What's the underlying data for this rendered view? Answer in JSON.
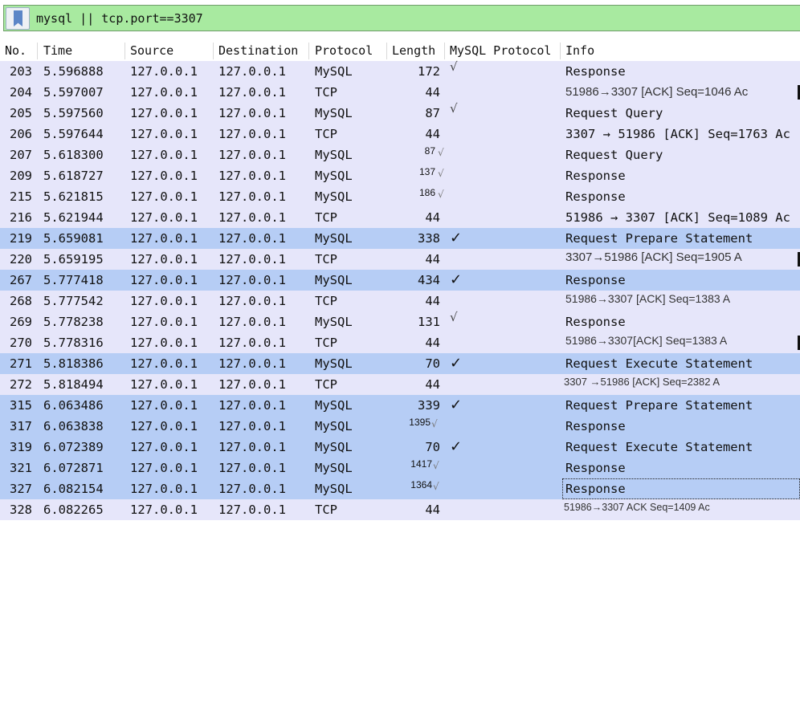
{
  "filter": {
    "text": "mysql || tcp.port==3307",
    "bookmark_icon": "bookmark-icon"
  },
  "columns": [
    "No.",
    "Time",
    "Source",
    "Destination",
    "Protocol",
    "Length",
    "MySQL Protocol",
    "Info"
  ],
  "rows": [
    {
      "no": "203",
      "time": "5.596888",
      "src": "127.0.0.1",
      "dst": "127.0.0.1",
      "proto": "MySQL",
      "len": "172",
      "check": "√",
      "info": "Response"
    },
    {
      "no": "204",
      "time": "5.597007",
      "src": "127.0.0.1",
      "dst": "127.0.0.1",
      "proto": "TCP",
      "len": "44",
      "check": "",
      "info": "51986→3307 [ACK] Seq=1046 Ac"
    },
    {
      "no": "205",
      "time": "5.597560",
      "src": "127.0.0.1",
      "dst": "127.0.0.1",
      "proto": "MySQL",
      "len": "87",
      "check": "√",
      "info": "Request Query"
    },
    {
      "no": "206",
      "time": "5.597644",
      "src": "127.0.0.1",
      "dst": "127.0.0.1",
      "proto": "TCP",
      "len": "44",
      "check": "",
      "info": "3307 → 51986 [ACK] Seq=1763 Ac"
    },
    {
      "no": "207",
      "time": "5.618300",
      "src": "127.0.0.1",
      "dst": "127.0.0.1",
      "proto": "MySQL",
      "len": "87",
      "check": "√",
      "info": "Request Query"
    },
    {
      "no": "209",
      "time": "5.618727",
      "src": "127.0.0.1",
      "dst": "127.0.0.1",
      "proto": "MySQL",
      "len": "137",
      "check": "√",
      "info": "Response"
    },
    {
      "no": "215",
      "time": "5.621815",
      "src": "127.0.0.1",
      "dst": "127.0.0.1",
      "proto": "MySQL",
      "len": "186",
      "check": "√",
      "info": "Response"
    },
    {
      "no": "216",
      "time": "5.621944",
      "src": "127.0.0.1",
      "dst": "127.0.0.1",
      "proto": "TCP",
      "len": "44",
      "check": "",
      "info": "51986 → 3307 [ACK] Seq=1089 Ac"
    },
    {
      "no": "219",
      "time": "5.659081",
      "src": "127.0.0.1",
      "dst": "127.0.0.1",
      "proto": "MySQL",
      "len": "338",
      "check": "✓",
      "info": "Request Prepare Statement"
    },
    {
      "no": "220",
      "time": "5.659195",
      "src": "127.0.0.1",
      "dst": "127.0.0.1",
      "proto": "TCP",
      "len": "44",
      "check": "",
      "info": "3307→51986 [ACK] Seq=1905 A"
    },
    {
      "no": "267",
      "time": "5.777418",
      "src": "127.0.0.1",
      "dst": "127.0.0.1",
      "proto": "MySQL",
      "len": "434",
      "check": "✓",
      "info": "Response"
    },
    {
      "no": "268",
      "time": "5.777542",
      "src": "127.0.0.1",
      "dst": "127.0.0.1",
      "proto": "TCP",
      "len": "44",
      "check": "",
      "info": "51986→3307 [ACK] Seq=1383 A"
    },
    {
      "no": "269",
      "time": "5.778238",
      "src": "127.0.0.1",
      "dst": "127.0.0.1",
      "proto": "MySQL",
      "len": "131",
      "check": "√",
      "info": "Response"
    },
    {
      "no": "270",
      "time": "5.778316",
      "src": "127.0.0.1",
      "dst": "127.0.0.1",
      "proto": "TCP",
      "len": "44",
      "check": "",
      "info": "51986→3307[ACK] Seq=1383 A"
    },
    {
      "no": "271",
      "time": "5.818386",
      "src": "127.0.0.1",
      "dst": "127.0.0.1",
      "proto": "MySQL",
      "len": "70",
      "check": "✓",
      "info": "Request Execute Statement"
    },
    {
      "no": "272",
      "time": "5.818494",
      "src": "127.0.0.1",
      "dst": "127.0.0.1",
      "proto": "TCP",
      "len": "44",
      "check": "",
      "info": "3307 →51986 [ACK] Seq=2382 A"
    },
    {
      "no": "315",
      "time": "6.063486",
      "src": "127.0.0.1",
      "dst": "127.0.0.1",
      "proto": "MySQL",
      "len": "339",
      "check": "✓",
      "info": "Request Prepare Statement"
    },
    {
      "no": "317",
      "time": "6.063838",
      "src": "127.0.0.1",
      "dst": "127.0.0.1",
      "proto": "MySQL",
      "len": "1395",
      "check": "√",
      "info": "Response"
    },
    {
      "no": "319",
      "time": "6.072389",
      "src": "127.0.0.1",
      "dst": "127.0.0.1",
      "proto": "MySQL",
      "len": "70",
      "check": "✓",
      "info": "Request Execute Statement"
    },
    {
      "no": "321",
      "time": "6.072871",
      "src": "127.0.0.1",
      "dst": "127.0.0.1",
      "proto": "MySQL",
      "len": "1417",
      "check": "√",
      "info": "Response"
    },
    {
      "no": "327",
      "time": "6.082154",
      "src": "127.0.0.1",
      "dst": "127.0.0.1",
      "proto": "MySQL",
      "len": "1364",
      "check": "√",
      "info": "Response"
    },
    {
      "no": "328",
      "time": "6.082265",
      "src": "127.0.0.1",
      "dst": "127.0.0.1",
      "proto": "TCP",
      "len": "44",
      "check": "",
      "info": "51986→3307 ACK Seq=1409 Ac"
    }
  ],
  "colors": {
    "filter_bg": "#a8eaa0",
    "row_normal": "#e6e6fa",
    "row_selected": "#b6cdf5"
  }
}
